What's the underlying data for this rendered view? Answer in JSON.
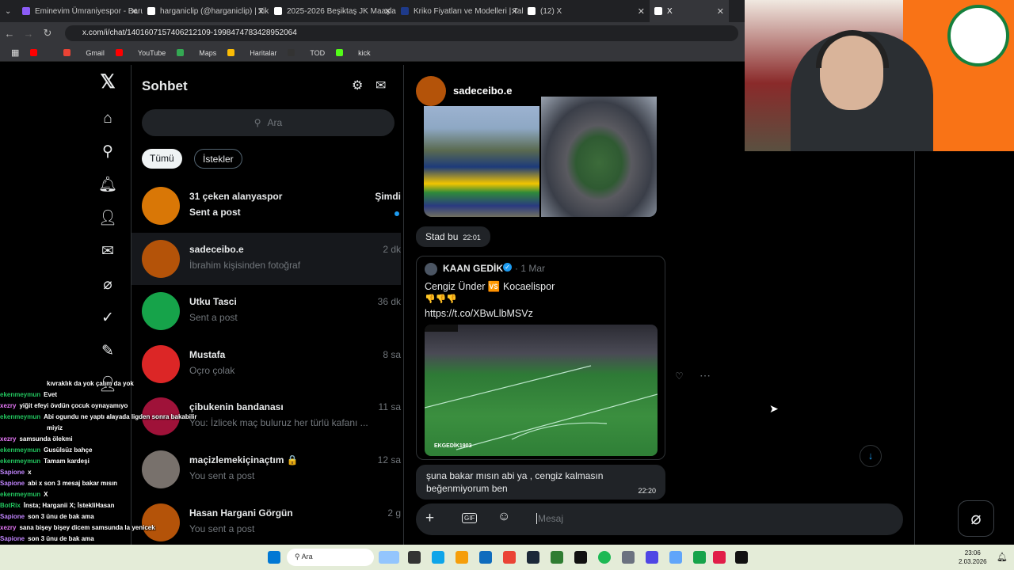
{
  "browser": {
    "tabs": [
      {
        "title": "Eminevim Ümraniyespor - Baru",
        "color": "#8b5cf6"
      },
      {
        "title": "harganiclip (@harganiclip) | Tik",
        "color": "#ffffff"
      },
      {
        "title": "2025-2026 Beşiktaş JK Maaşlar",
        "color": "#ffffff"
      },
      {
        "title": "Kriko Fiyatları ve Modelleri | Tal",
        "color": "#1e3a8a"
      },
      {
        "title": "(12) X",
        "color": "#ffffff"
      },
      {
        "title": "X",
        "color": "#ffffff"
      }
    ],
    "url": "x.com/i/chat/1401607157406212109-1998474783428952064",
    "bookmarks": [
      {
        "label": "",
        "color": "#ff0000"
      },
      {
        "label": "Gmail",
        "color": "#ea4335"
      },
      {
        "label": "YouTube",
        "color": "#ff0000"
      },
      {
        "label": "Maps",
        "color": "#34a853"
      },
      {
        "label": "Haritalar",
        "color": "#fbbc05"
      },
      {
        "label": "TOD",
        "color": "#333333"
      },
      {
        "label": "kick",
        "color": "#53fc18"
      }
    ]
  },
  "sidebar": {
    "icons": [
      "x-logo-icon",
      "home-icon",
      "search-icon",
      "bell-icon",
      "add-user-icon",
      "mail-icon",
      "grok-icon",
      "verified-icon",
      "compose-icon",
      "profile-icon",
      "more-icon"
    ]
  },
  "chatlist": {
    "title": "Sohbet",
    "search_placeholder": "Ara",
    "filters": [
      "Tümü",
      "İstekler"
    ],
    "conversations": [
      {
        "name": "31 çeken alanyaspor",
        "time": "Şimdi",
        "preview": "Sent a post",
        "unread": true,
        "color": "#d97706"
      },
      {
        "name": "sadeceibo.e",
        "time": "2 dk",
        "preview": "İbrahim kişisinden fotoğraf",
        "color": "#b45309"
      },
      {
        "name": "Utku Tasci",
        "time": "36 dk",
        "preview": "Sent a post",
        "color": "#16a34a"
      },
      {
        "name": "Mustafa",
        "time": "8 sa",
        "preview": "Oçro çolak",
        "color": "#dc2626"
      },
      {
        "name": "çibukenin bandanası",
        "time": "11 sa",
        "preview": "You: İzlicek maç buluruz her türlü kafanı ...",
        "color": "#9f1239"
      },
      {
        "name": "maçizlemekiçinaçtım 🔒",
        "time": "12 sa",
        "preview": "You sent a post",
        "color": "#78716c"
      },
      {
        "name": "Hasan Hargani Görgün",
        "time": "2 g",
        "preview": "You sent a post",
        "color": "#b45309"
      }
    ]
  },
  "chat": {
    "sender_name": "sadeceibo.e",
    "msg1": {
      "text": "Stad bu",
      "time": "22:01"
    },
    "post": {
      "author": "KAAN GEDİK",
      "date": "1 Mar",
      "line1": "Cengiz Ünder 🆚 Kocaelispor",
      "line2": "👎👎👎",
      "link": "https://t.co/XBwLlbMSVz",
      "watermark": "EKGEDİK1903"
    },
    "msg2": {
      "text": "şuna bakar mısın abi ya , cengiz kalmasın beğenmiyorum ben",
      "time": "22:20"
    },
    "composer_placeholder": "Mesaj"
  },
  "stream_chat": [
    {
      "user": "",
      "text": "kıvraklık da yok çalım da yok",
      "color": "#ffffff"
    },
    {
      "user": "ekenmeymun",
      "text": "Evet",
      "color": "#22c55e"
    },
    {
      "user": "xezry",
      "text": "yiğit efeyi övdün çocuk oynayamıyo",
      "color": "#e879f9"
    },
    {
      "user": "ekenmeymun",
      "text": "Abi ogundu ne yaptı alayada ligden sonra bakabilir",
      "color": "#22c55e"
    },
    {
      "user": "",
      "text": "miyiz",
      "color": "#ffffff"
    },
    {
      "user": "xezry",
      "text": "samsunda ölekmi",
      "color": "#e879f9"
    },
    {
      "user": "ekenmeymun",
      "text": "Gusülsüz bahçe",
      "color": "#22c55e"
    },
    {
      "user": "ekenmeymun",
      "text": "Tamam kardeşi",
      "color": "#22c55e"
    },
    {
      "user": "Sapione",
      "text": "x",
      "color": "#c084fc"
    },
    {
      "user": "Sapione",
      "text": "abi x son 3 mesaj bakar mısın",
      "color": "#c084fc"
    },
    {
      "user": "ekenmeymun",
      "text": "X",
      "color": "#22c55e"
    },
    {
      "user": "BotRix",
      "text": "İnsta; Harganii X; İstekliHasan",
      "color": "#22c55e"
    },
    {
      "user": "Sapione",
      "text": "son 3 ünu de bak ama",
      "color": "#c084fc"
    },
    {
      "user": "xezry",
      "text": "sana bişey bişey dicem samsunda la yenicek",
      "color": "#e879f9"
    },
    {
      "user": "Sapione",
      "text": "son 3 ünu de bak ama",
      "color": "#c084fc"
    }
  ],
  "taskbar": {
    "search": "Ara",
    "time": "23:06",
    "date": "2.03.2026"
  }
}
